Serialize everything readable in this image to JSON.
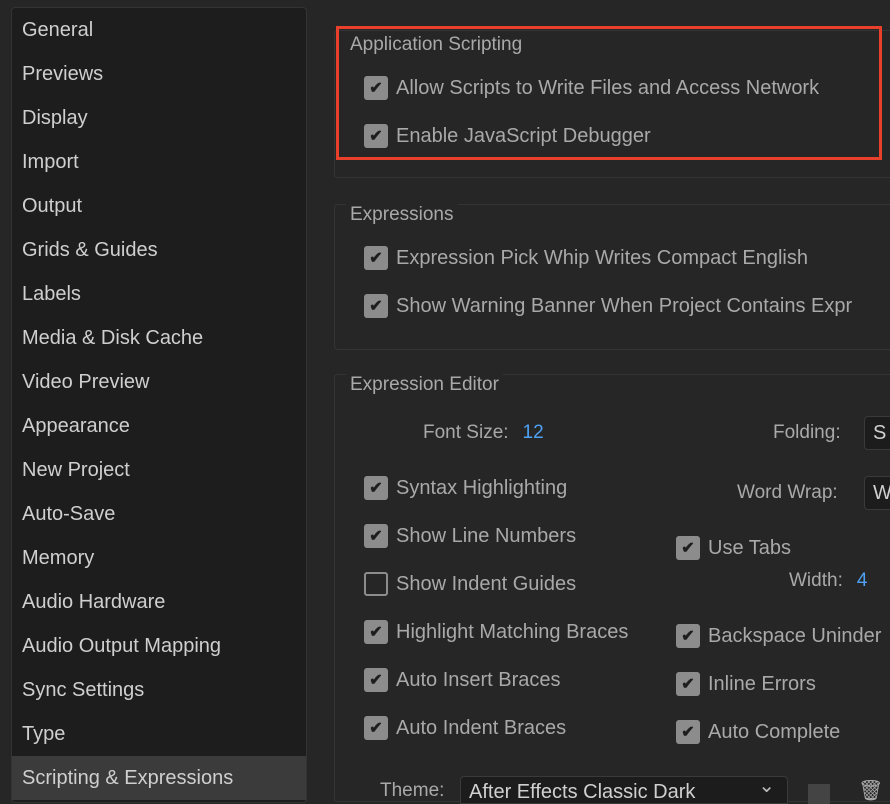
{
  "sidebar": {
    "items": [
      "General",
      "Previews",
      "Display",
      "Import",
      "Output",
      "Grids & Guides",
      "Labels",
      "Media & Disk Cache",
      "Video Preview",
      "Appearance",
      "New Project",
      "Auto-Save",
      "Memory",
      "Audio Hardware",
      "Audio Output Mapping",
      "Sync Settings",
      "Type",
      "Scripting & Expressions"
    ],
    "selected": "Scripting & Expressions"
  },
  "app_scripting": {
    "title": "Application Scripting",
    "allow_scripts": {
      "label": "Allow Scripts to Write Files and Access Network",
      "checked": true
    },
    "js_debugger": {
      "label": "Enable JavaScript Debugger",
      "checked": true
    }
  },
  "expressions": {
    "title": "Expressions",
    "pick_whip": {
      "label": "Expression Pick Whip Writes Compact English",
      "checked": true
    },
    "warning_banner": {
      "label": "Show Warning Banner When Project Contains Expr",
      "checked": true
    }
  },
  "editor": {
    "title": "Expression Editor",
    "font_size_label": "Font Size:",
    "font_size": "12",
    "folding_label": "Folding:",
    "folding_value": "S",
    "word_wrap_label": "Word Wrap:",
    "word_wrap_value": "W",
    "width_label": "Width:",
    "width_value": "4",
    "left": [
      {
        "label": "Syntax Highlighting",
        "checked": true
      },
      {
        "label": "Show Line Numbers",
        "checked": true
      },
      {
        "label": "Show Indent Guides",
        "checked": false
      },
      {
        "label": "Highlight Matching Braces",
        "checked": true
      },
      {
        "label": "Auto Insert Braces",
        "checked": true
      },
      {
        "label": "Auto Indent Braces",
        "checked": true
      }
    ],
    "right": [
      {
        "label": "Use Tabs",
        "checked": true
      },
      {
        "label": "Backspace Uninder",
        "checked": true
      },
      {
        "label": "Inline Errors",
        "checked": true
      },
      {
        "label": "Auto Complete",
        "checked": true
      }
    ],
    "theme_label": "Theme:",
    "theme_value": "After Effects Classic Dark"
  },
  "check_glyph": "✔",
  "chevron": "⌄",
  "trash": "🗑",
  "colors": {
    "highlight": "#e8402a",
    "value": "#4ea1f3"
  }
}
